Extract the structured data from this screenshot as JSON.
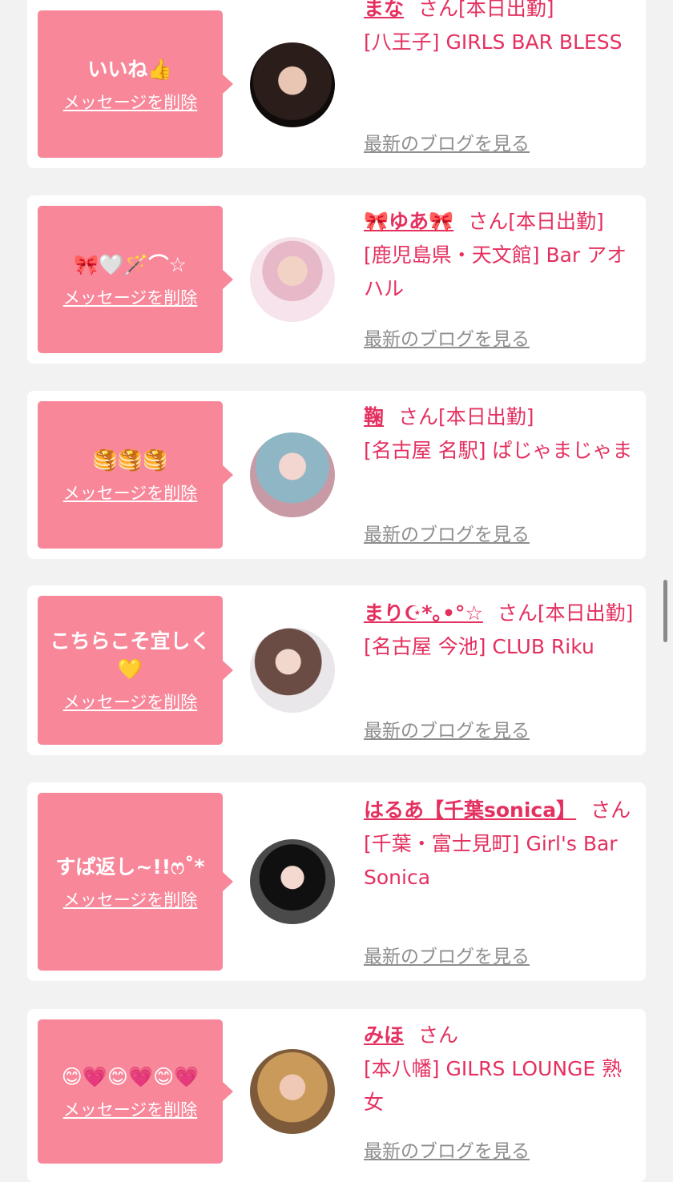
{
  "delete_label": "メッセージを削除",
  "blog_label": "最新のブログを見る",
  "accent_color": "#e4305f",
  "bubble_color": "#f8879a",
  "items": [
    {
      "message": "いいね👍",
      "name": "まな",
      "suffix": "さん[本日出勤]",
      "shop": "[八王子] GIRLS BAR BLESS"
    },
    {
      "message": "🎀🤍🪄⌒☆",
      "name": "🎀ゆあ🎀",
      "suffix": "さん[本日出勤]",
      "shop": "[鹿児島県・天文館] Bar アオハル"
    },
    {
      "message": "🥞🥞🥞",
      "name": "鞠",
      "suffix": "さん[本日出勤]",
      "shop": "[名古屋 名駅] ぱじゃまじゃま"
    },
    {
      "message": "こちらこそ宜しく💛",
      "name": "まり☪︎*｡•°☆",
      "suffix": "さん[本日出勤]",
      "shop": "[名古屋 今池] CLUB Riku"
    },
    {
      "message": "すぱ返し~!!ෆ˚*",
      "name": "はるあ【千葉sonica】",
      "suffix": "さん",
      "shop": "[千葉・富士見町] Girl's Bar Sonica"
    },
    {
      "message": "😊💗😊💗😊💗",
      "name": "みほ",
      "suffix": "さん",
      "shop": "[本八幡] GILRS LOUNGE 熟女"
    }
  ]
}
